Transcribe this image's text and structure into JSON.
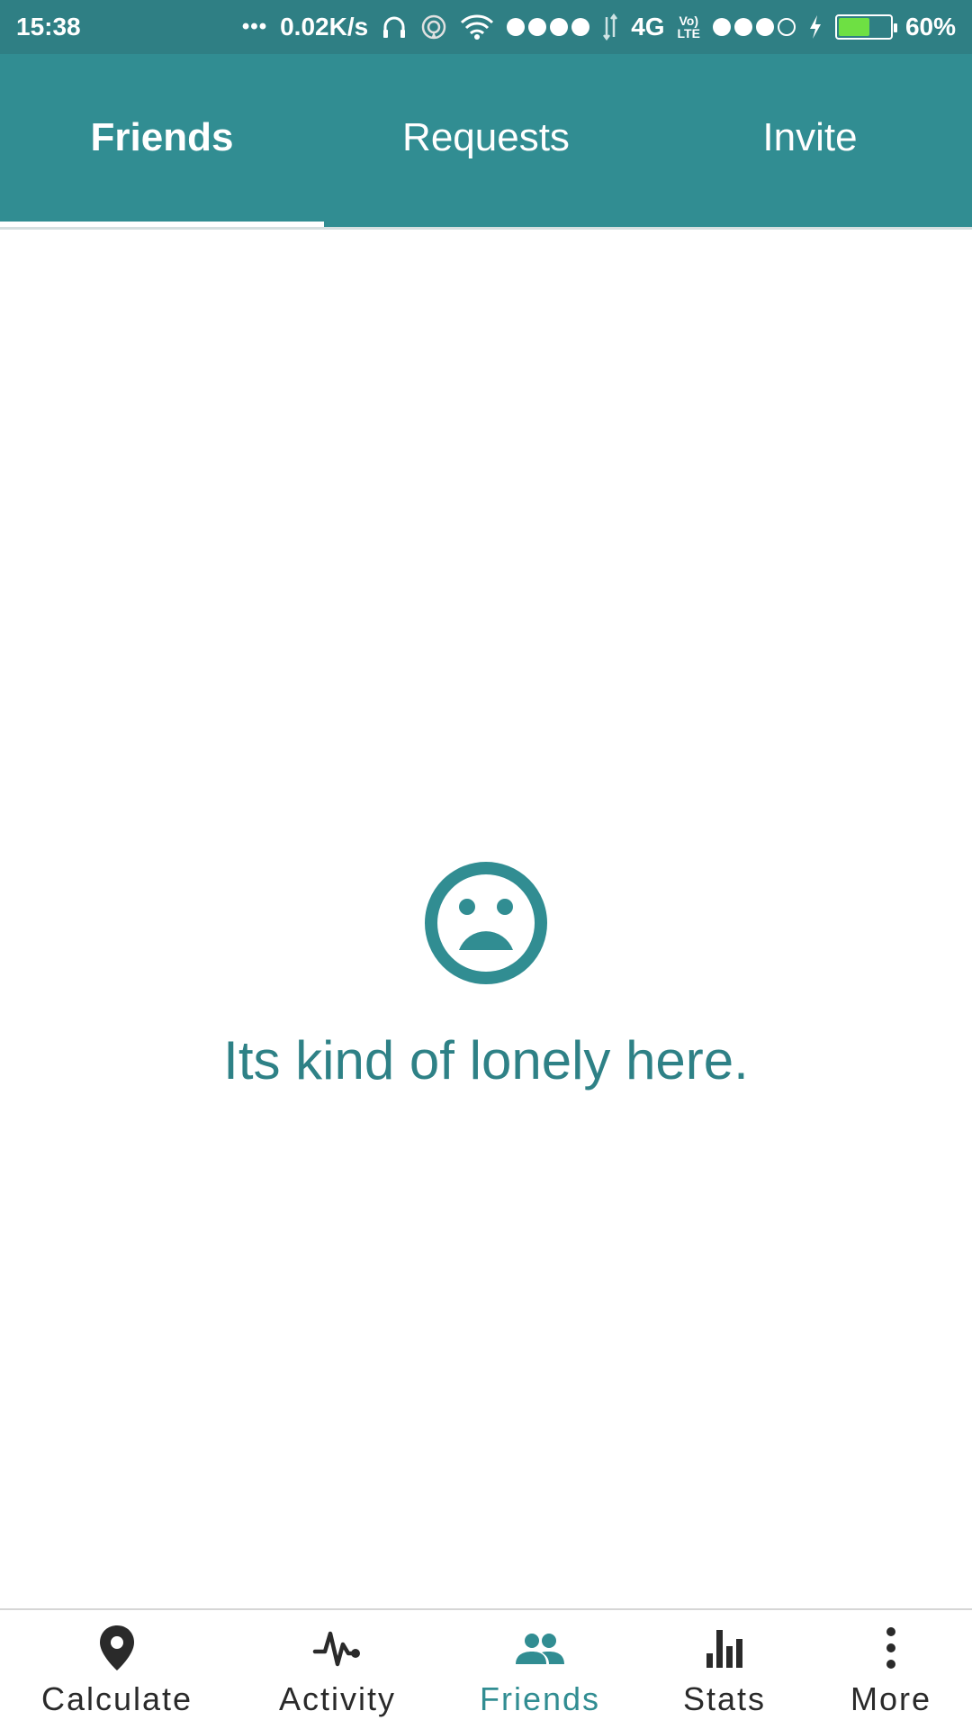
{
  "status_bar": {
    "time": "15:38",
    "more_dots": "•••",
    "net_speed": "0.02K/s",
    "network_type": "4G",
    "volte_top": "Vo)",
    "volte_bottom": "LTE",
    "battery_percent_label": "60%",
    "battery_level": 0.6
  },
  "tabs": [
    {
      "label": "Friends",
      "active": true
    },
    {
      "label": "Requests",
      "active": false
    },
    {
      "label": "Invite",
      "active": false
    }
  ],
  "empty_state": {
    "icon": "sad-face-icon",
    "message": "Its kind of lonely here."
  },
  "bottom_nav": [
    {
      "label": "Calculate",
      "icon": "location-pin-icon",
      "active": false
    },
    {
      "label": "Activity",
      "icon": "pulse-icon",
      "active": false
    },
    {
      "label": "Friends",
      "icon": "people-icon",
      "active": true
    },
    {
      "label": "Stats",
      "icon": "bar-chart-icon",
      "active": false
    },
    {
      "label": "More",
      "icon": "more-vertical-icon",
      "active": false
    }
  ],
  "colors": {
    "primary": "#318d92",
    "status_bar": "#2f7f84",
    "accent_text": "#2e8186",
    "battery_fill": "#6ee043",
    "nav_inactive": "#2a2a2a"
  }
}
